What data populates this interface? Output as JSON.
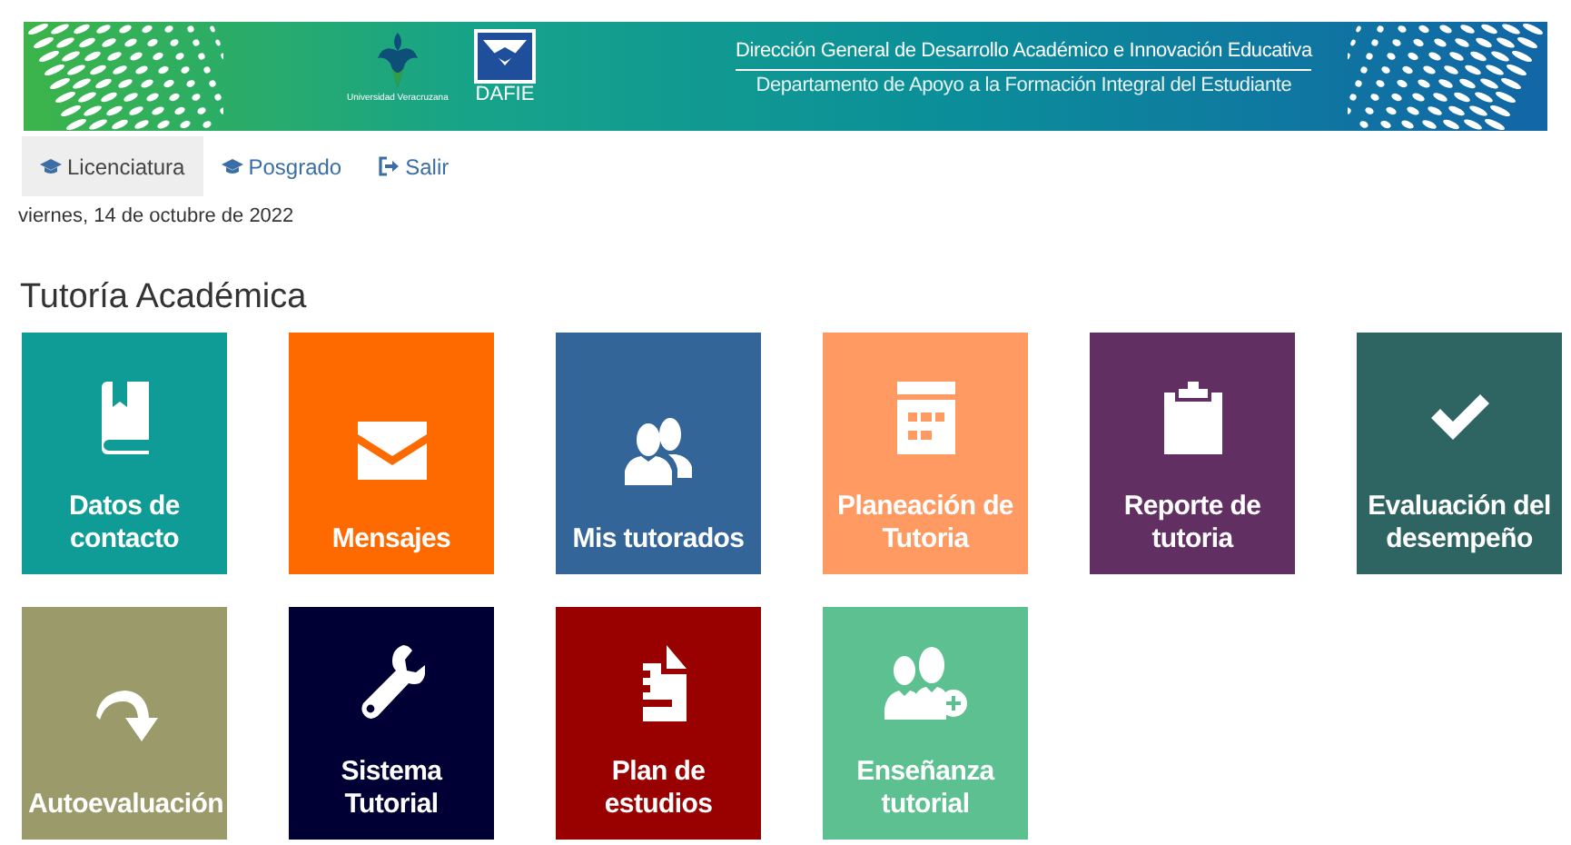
{
  "banner": {
    "university": "Universidad Veracruzana",
    "logo_text": "DAFIE",
    "title": "Dirección General de Desarrollo Académico e Innovación Educativa",
    "subtitle": "Departamento de Apoyo a la Formación Integral del Estudiante"
  },
  "nav": [
    {
      "label": "Licenciatura",
      "kind": "cap",
      "selected": true
    },
    {
      "label": "Posgrado",
      "kind": "cap",
      "selected": false
    },
    {
      "label": "Salir",
      "kind": "exit",
      "selected": false
    }
  ],
  "date": "viernes, 14 de octubre de 2022",
  "heading": "Tutoría Académica",
  "tiles": [
    {
      "label": "Datos de contacto",
      "kind": "book",
      "color": "#0f9b96"
    },
    {
      "label": "Mensajes",
      "kind": "envelope",
      "color": "#ff6a00"
    },
    {
      "label": "Mis tutorados",
      "kind": "people",
      "color": "#336598"
    },
    {
      "label": "Planeación de Tutoria",
      "kind": "calendar",
      "color": "#ff9a62"
    },
    {
      "label": "Reporte de tutoria",
      "kind": "clipboard",
      "color": "#622f62"
    },
    {
      "label": "Evaluación del desempeño",
      "kind": "check",
      "color": "#2e6563"
    },
    {
      "label": "Autoevaluación",
      "kind": "arrow",
      "color": "#9b9a6b"
    },
    {
      "label": "Sistema Tutorial",
      "kind": "wrench",
      "color": "#010035"
    },
    {
      "label": "Plan de estudios",
      "kind": "document",
      "color": "#990000"
    },
    {
      "label": "Enseñanza tutorial",
      "kind": "people-plus",
      "color": "#5cc091"
    }
  ]
}
